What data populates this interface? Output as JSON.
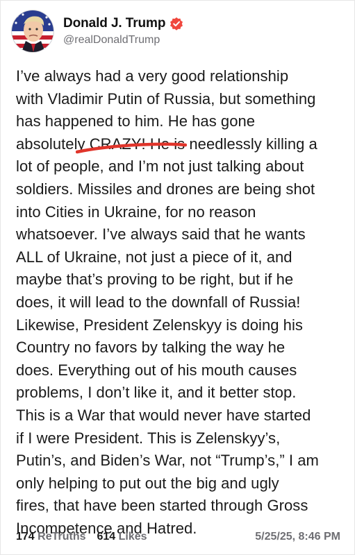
{
  "author": {
    "display_name": "Donald J. Trump",
    "handle": "@realDonaldTrump",
    "verified_icon": "verified-badge-icon",
    "avatar_icon": "profile-avatar"
  },
  "post": {
    "text": "I’ve always had a very good relationship\nwith Vladimir Putin of Russia, but something\nhas happened to him. He has gone\nabsolutely CRAZY! He is needlessly killing a\nlot of people, and I’m not just talking about\nsoldiers. Missiles and drones are being shot\ninto Cities in Ukraine, for no reason\nwhatsoever. I’ve always said that he wants\nALL of Ukraine, not just a piece of it, and\nmaybe that’s proving to be right, but if he\ndoes, it will lead to the downfall of Russia!\nLikewise, President Zelenskyy is doing his\nCountry no favors by talking the way he\ndoes. Everything out of his mouth causes\nproblems, I don’t like it, and it better stop.\nThis is a War that would never have started\nif I were President. This is Zelenskyy’s,\nPutin’s, and Biden’s War, not “Trump’s,” I am\nonly helping to put out the big and ugly\nfires, that have been started through Gross\nIncompetence and Hatred."
  },
  "footer": {
    "retruths_count": "174",
    "retruths_label": "ReTruths",
    "likes_count": "614",
    "likes_label": "Likes",
    "timestamp": "5/25/25, 8:46 PM"
  },
  "colors": {
    "verified": "#f0483e",
    "underline_mark": "#e0352b",
    "muted_text": "#6e6e73"
  }
}
